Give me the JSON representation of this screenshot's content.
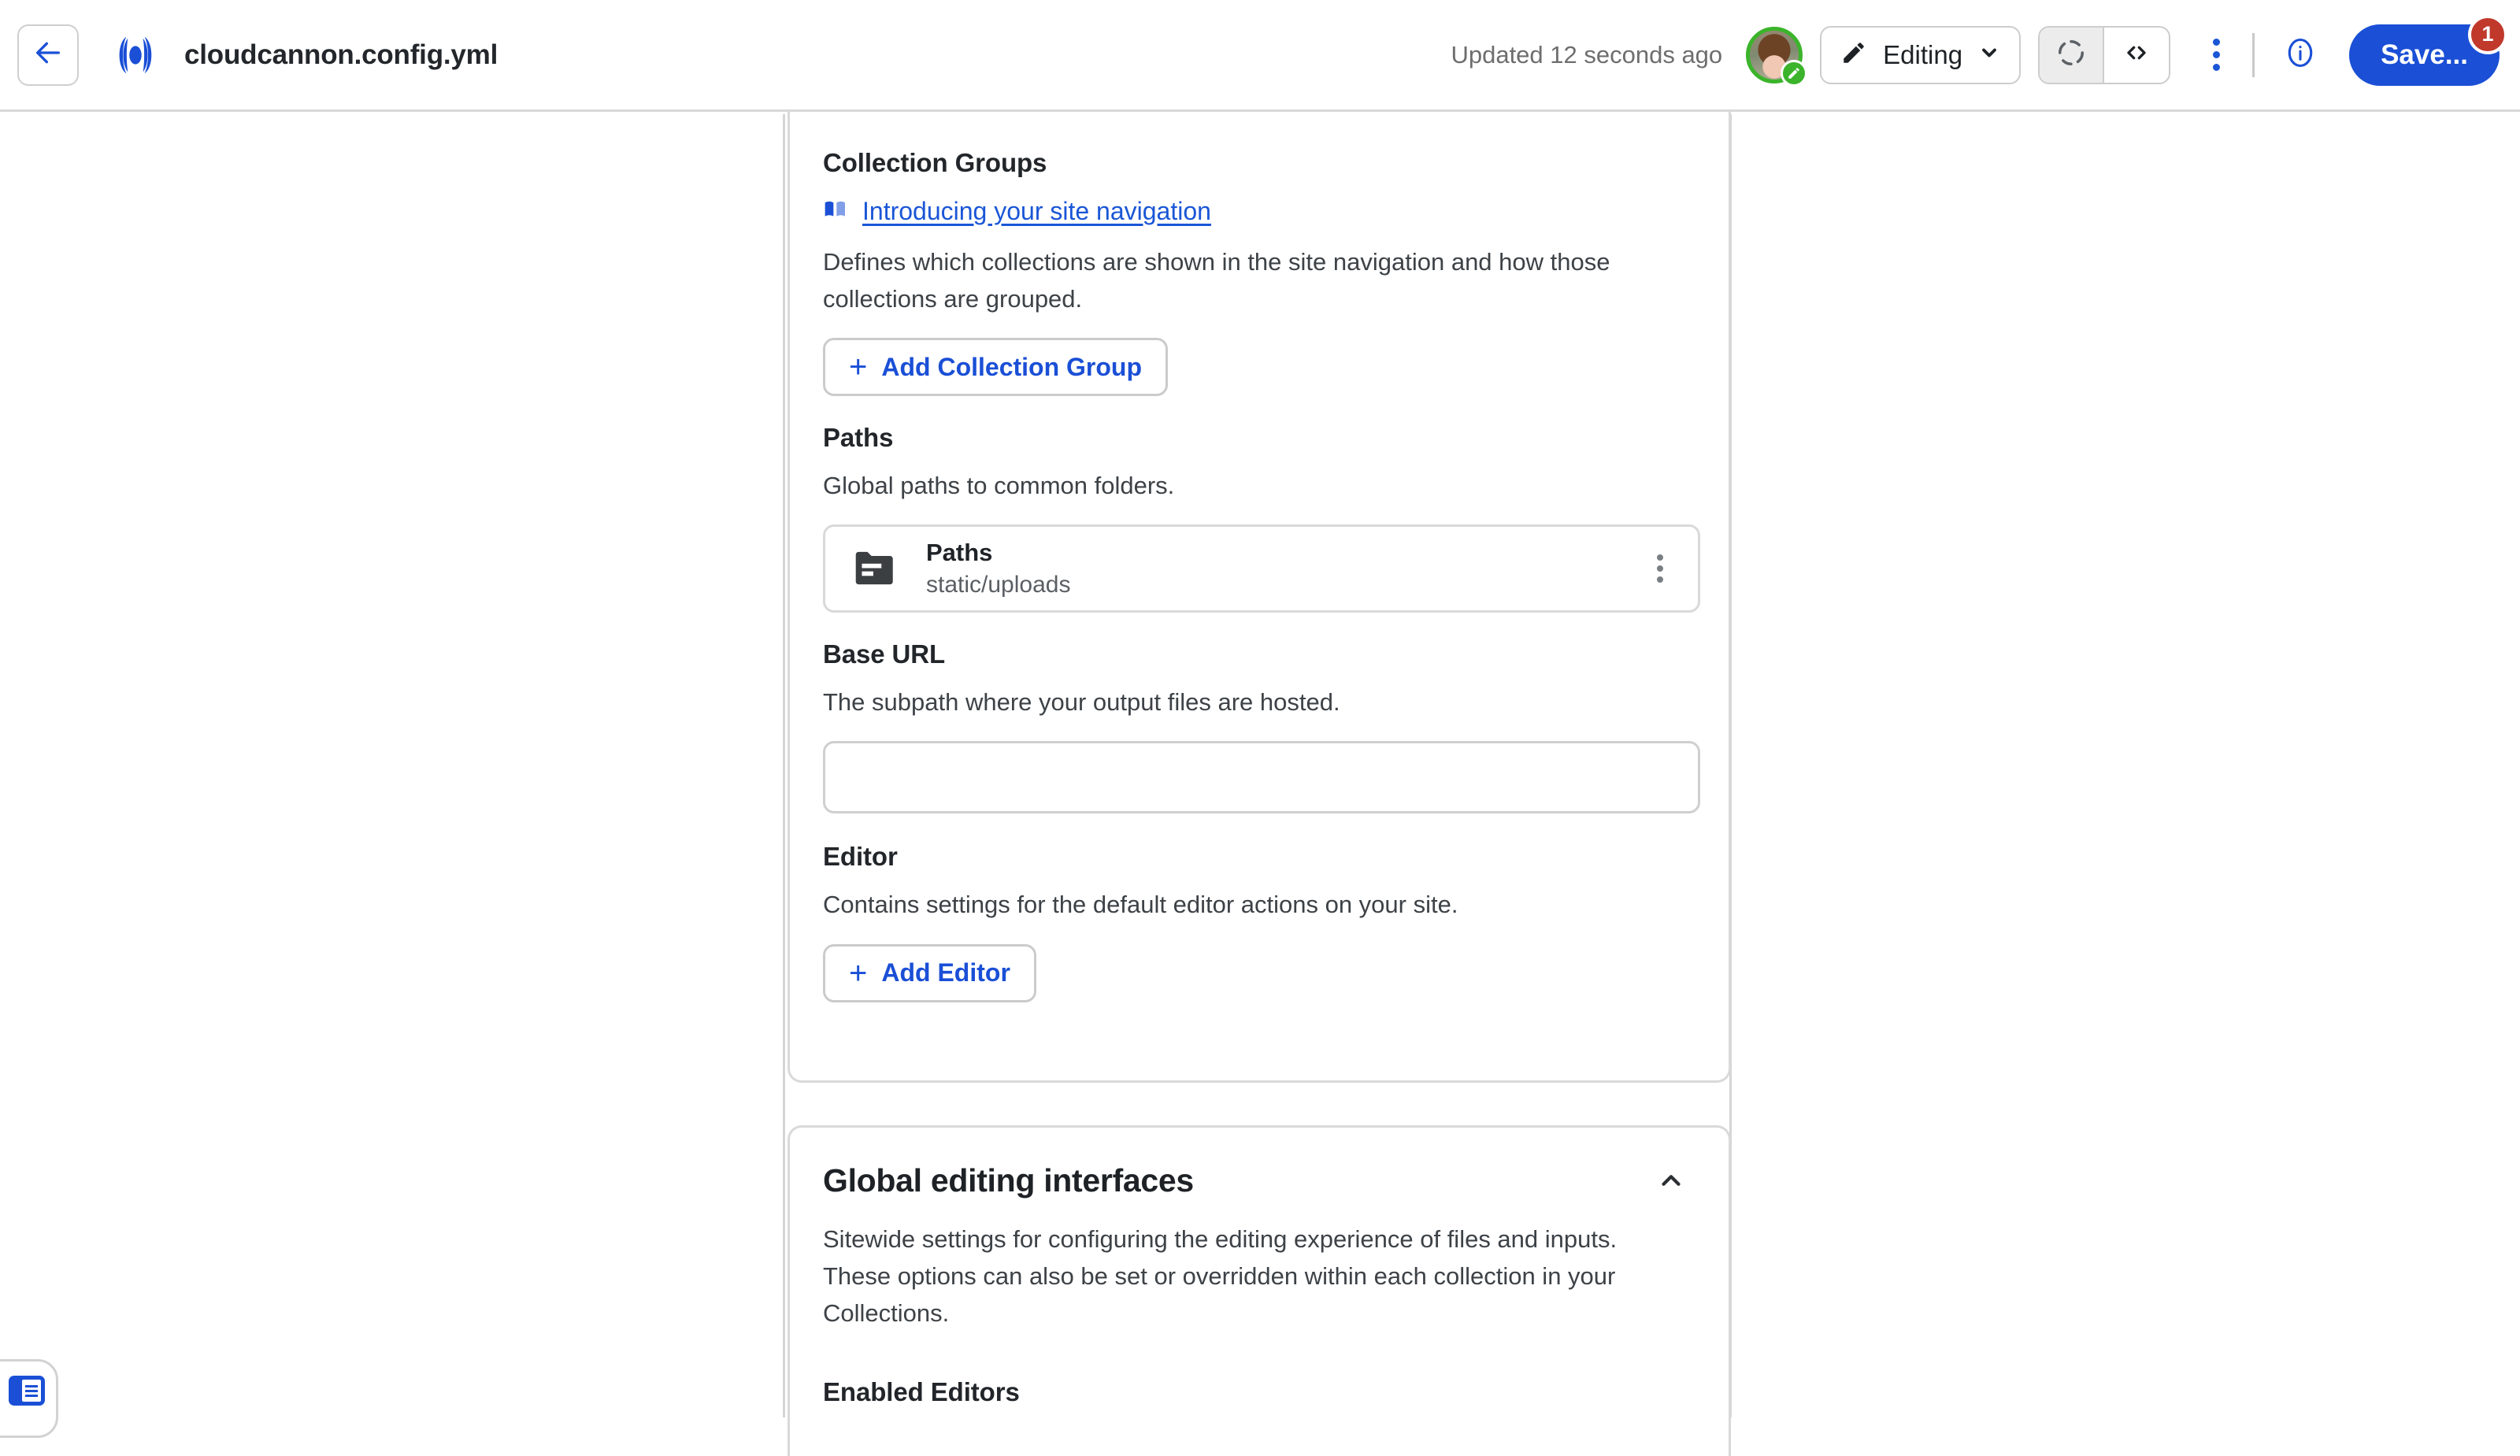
{
  "topbar": {
    "back_icon": "arrow-left-icon",
    "logo_icon": "cloudcannon-logo-icon",
    "file_title": "cloudcannon.config.yml",
    "updated_text": "Updated 12 seconds ago",
    "avatar_icon": "user-avatar",
    "avatar_badge_icon": "pencil-icon",
    "editing_label": "Editing",
    "editing_icon": "pencil-icon",
    "editing_chevron_icon": "chevron-down-icon",
    "sync_icon": "sync-spinner-icon",
    "code_icon": "code-brackets-icon",
    "kebab_icon": "kebab-menu-icon",
    "info_icon": "info-circle-icon",
    "save_label": "Save...",
    "save_badge": "1",
    "accent_blue": "#1a4fd6",
    "badge_red": "#c0392b",
    "status_green": "#3bb42b"
  },
  "config_card": {
    "collection_groups": {
      "title": "Collection Groups",
      "doc_link": "Introducing your site navigation",
      "doc_icon": "book-icon",
      "description": "Defines which collections are shown in the site navigation and how those collections are grouped.",
      "add_button": "Add Collection Group",
      "add_icon": "plus-icon"
    },
    "paths": {
      "title": "Paths",
      "description": "Global paths to common folders.",
      "item": {
        "icon": "folder-icon",
        "title": "Paths",
        "subtitle": "static/uploads",
        "kebab_icon": "kebab-menu-icon"
      }
    },
    "base_url": {
      "title": "Base URL",
      "description": "The subpath where your output files are hosted.",
      "value": "",
      "placeholder": ""
    },
    "editor": {
      "title": "Editor",
      "description": "Contains settings for the default editor actions on your site.",
      "add_button": "Add Editor",
      "add_icon": "plus-icon"
    }
  },
  "global_card": {
    "title": "Global editing interfaces",
    "collapse_icon": "chevron-up-icon",
    "description": "Sitewide settings for configuring the editing experience of files and inputs. These options can also be set or overridden within each collection in your Collections.",
    "subsection_title": "Enabled Editors"
  },
  "help_widget": {
    "icon": "documentation-panel-icon"
  }
}
